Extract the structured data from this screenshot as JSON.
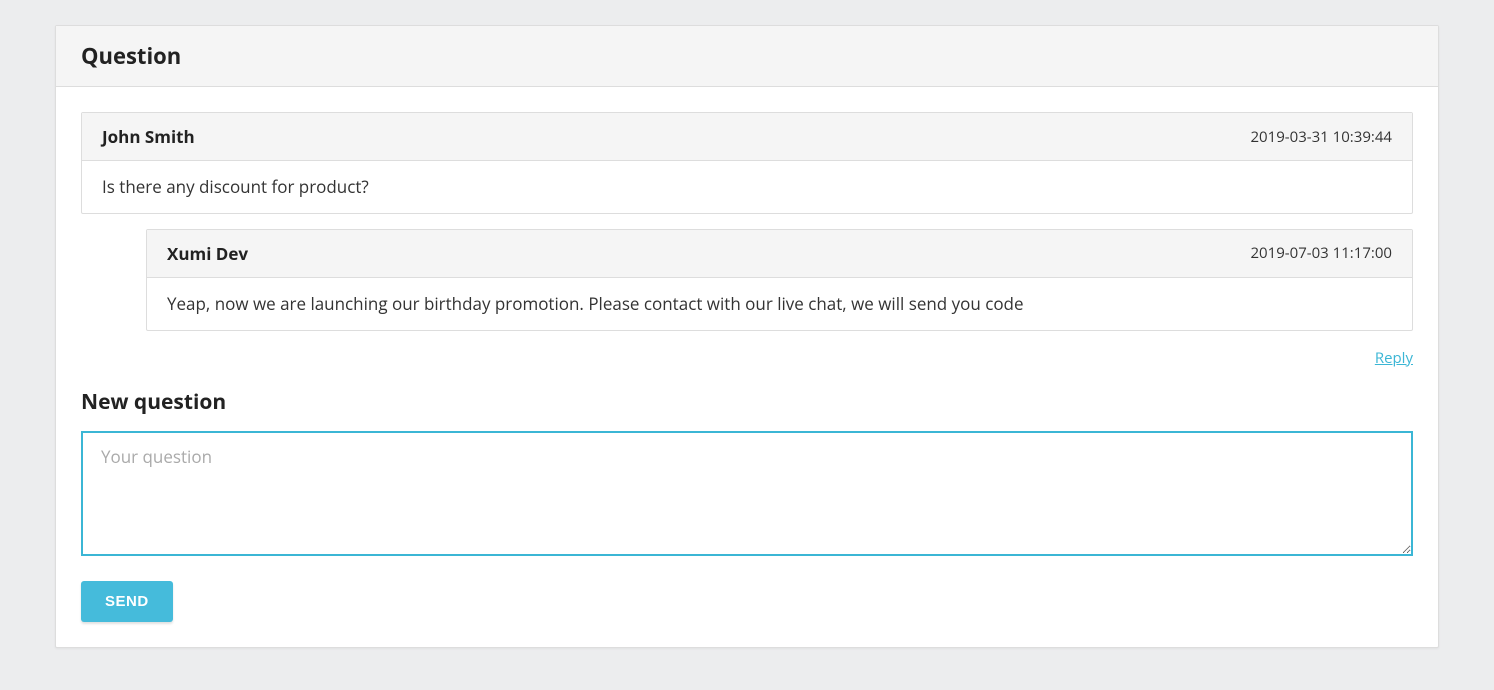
{
  "panel": {
    "title": "Question"
  },
  "messages": [
    {
      "author": "John Smith",
      "timestamp": "2019-03-31 10:39:44",
      "body": "Is there any discount for product?"
    },
    {
      "author": "Xumi Dev",
      "timestamp": "2019-07-03 11:17:00",
      "body": "Yeap, now we are launching our birthday promotion. Please contact with our live chat, we will send you code"
    }
  ],
  "reply_link": "Reply",
  "new_question": {
    "title": "New question",
    "placeholder": "Your question",
    "send_label": "SEND"
  }
}
